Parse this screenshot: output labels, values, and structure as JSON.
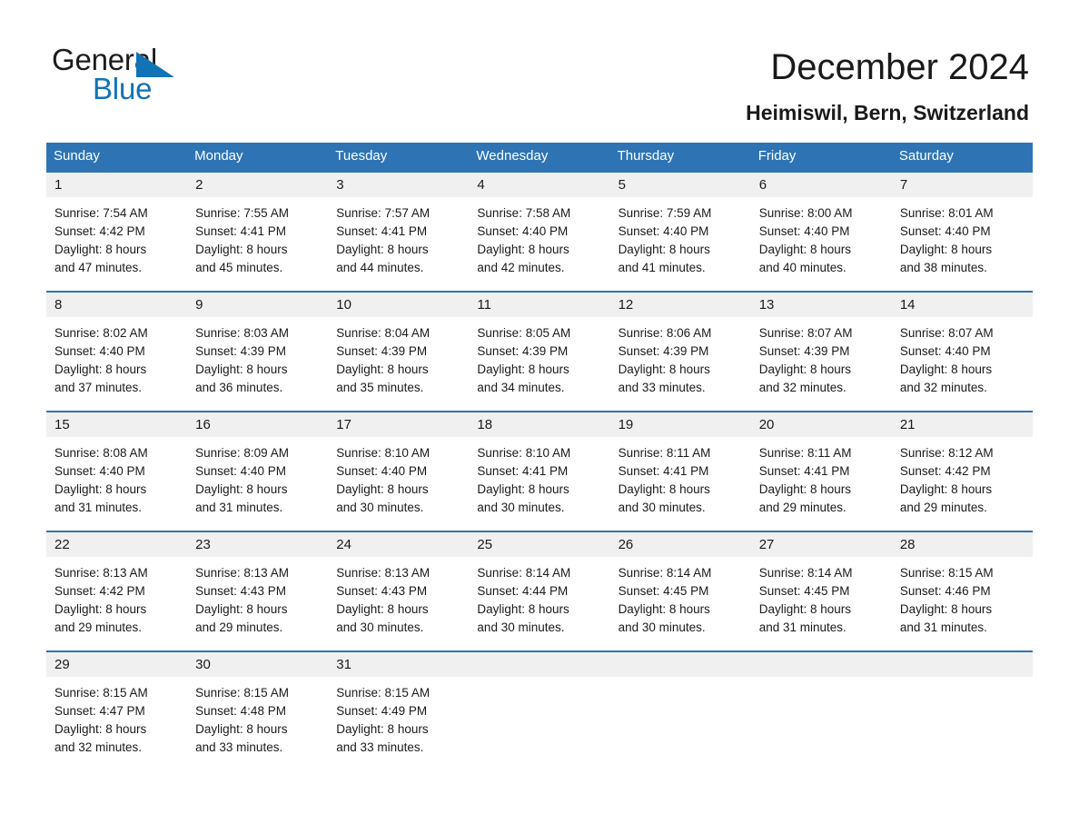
{
  "logo": {
    "word_black": "General",
    "word_blue": "Blue",
    "triangle_color": "#1272b6"
  },
  "header": {
    "title": "December 2024",
    "subtitle": "Heimiswil, Bern, Switzerland"
  },
  "colors": {
    "header_blue": "#2e74b5",
    "daynum_band": "#f0f0f0",
    "text": "#1a1a1a"
  },
  "weekday_headers": [
    "Sunday",
    "Monday",
    "Tuesday",
    "Wednesday",
    "Thursday",
    "Friday",
    "Saturday"
  ],
  "weeks": [
    [
      {
        "day": "1",
        "sunrise": "Sunrise: 7:54 AM",
        "sunset": "Sunset: 4:42 PM",
        "daylight_line1": "Daylight: 8 hours",
        "daylight_line2": "and 47 minutes."
      },
      {
        "day": "2",
        "sunrise": "Sunrise: 7:55 AM",
        "sunset": "Sunset: 4:41 PM",
        "daylight_line1": "Daylight: 8 hours",
        "daylight_line2": "and 45 minutes."
      },
      {
        "day": "3",
        "sunrise": "Sunrise: 7:57 AM",
        "sunset": "Sunset: 4:41 PM",
        "daylight_line1": "Daylight: 8 hours",
        "daylight_line2": "and 44 minutes."
      },
      {
        "day": "4",
        "sunrise": "Sunrise: 7:58 AM",
        "sunset": "Sunset: 4:40 PM",
        "daylight_line1": "Daylight: 8 hours",
        "daylight_line2": "and 42 minutes."
      },
      {
        "day": "5",
        "sunrise": "Sunrise: 7:59 AM",
        "sunset": "Sunset: 4:40 PM",
        "daylight_line1": "Daylight: 8 hours",
        "daylight_line2": "and 41 minutes."
      },
      {
        "day": "6",
        "sunrise": "Sunrise: 8:00 AM",
        "sunset": "Sunset: 4:40 PM",
        "daylight_line1": "Daylight: 8 hours",
        "daylight_line2": "and 40 minutes."
      },
      {
        "day": "7",
        "sunrise": "Sunrise: 8:01 AM",
        "sunset": "Sunset: 4:40 PM",
        "daylight_line1": "Daylight: 8 hours",
        "daylight_line2": "and 38 minutes."
      }
    ],
    [
      {
        "day": "8",
        "sunrise": "Sunrise: 8:02 AM",
        "sunset": "Sunset: 4:40 PM",
        "daylight_line1": "Daylight: 8 hours",
        "daylight_line2": "and 37 minutes."
      },
      {
        "day": "9",
        "sunrise": "Sunrise: 8:03 AM",
        "sunset": "Sunset: 4:39 PM",
        "daylight_line1": "Daylight: 8 hours",
        "daylight_line2": "and 36 minutes."
      },
      {
        "day": "10",
        "sunrise": "Sunrise: 8:04 AM",
        "sunset": "Sunset: 4:39 PM",
        "daylight_line1": "Daylight: 8 hours",
        "daylight_line2": "and 35 minutes."
      },
      {
        "day": "11",
        "sunrise": "Sunrise: 8:05 AM",
        "sunset": "Sunset: 4:39 PM",
        "daylight_line1": "Daylight: 8 hours",
        "daylight_line2": "and 34 minutes."
      },
      {
        "day": "12",
        "sunrise": "Sunrise: 8:06 AM",
        "sunset": "Sunset: 4:39 PM",
        "daylight_line1": "Daylight: 8 hours",
        "daylight_line2": "and 33 minutes."
      },
      {
        "day": "13",
        "sunrise": "Sunrise: 8:07 AM",
        "sunset": "Sunset: 4:39 PM",
        "daylight_line1": "Daylight: 8 hours",
        "daylight_line2": "and 32 minutes."
      },
      {
        "day": "14",
        "sunrise": "Sunrise: 8:07 AM",
        "sunset": "Sunset: 4:40 PM",
        "daylight_line1": "Daylight: 8 hours",
        "daylight_line2": "and 32 minutes."
      }
    ],
    [
      {
        "day": "15",
        "sunrise": "Sunrise: 8:08 AM",
        "sunset": "Sunset: 4:40 PM",
        "daylight_line1": "Daylight: 8 hours",
        "daylight_line2": "and 31 minutes."
      },
      {
        "day": "16",
        "sunrise": "Sunrise: 8:09 AM",
        "sunset": "Sunset: 4:40 PM",
        "daylight_line1": "Daylight: 8 hours",
        "daylight_line2": "and 31 minutes."
      },
      {
        "day": "17",
        "sunrise": "Sunrise: 8:10 AM",
        "sunset": "Sunset: 4:40 PM",
        "daylight_line1": "Daylight: 8 hours",
        "daylight_line2": "and 30 minutes."
      },
      {
        "day": "18",
        "sunrise": "Sunrise: 8:10 AM",
        "sunset": "Sunset: 4:41 PM",
        "daylight_line1": "Daylight: 8 hours",
        "daylight_line2": "and 30 minutes."
      },
      {
        "day": "19",
        "sunrise": "Sunrise: 8:11 AM",
        "sunset": "Sunset: 4:41 PM",
        "daylight_line1": "Daylight: 8 hours",
        "daylight_line2": "and 30 minutes."
      },
      {
        "day": "20",
        "sunrise": "Sunrise: 8:11 AM",
        "sunset": "Sunset: 4:41 PM",
        "daylight_line1": "Daylight: 8 hours",
        "daylight_line2": "and 29 minutes."
      },
      {
        "day": "21",
        "sunrise": "Sunrise: 8:12 AM",
        "sunset": "Sunset: 4:42 PM",
        "daylight_line1": "Daylight: 8 hours",
        "daylight_line2": "and 29 minutes."
      }
    ],
    [
      {
        "day": "22",
        "sunrise": "Sunrise: 8:13 AM",
        "sunset": "Sunset: 4:42 PM",
        "daylight_line1": "Daylight: 8 hours",
        "daylight_line2": "and 29 minutes."
      },
      {
        "day": "23",
        "sunrise": "Sunrise: 8:13 AM",
        "sunset": "Sunset: 4:43 PM",
        "daylight_line1": "Daylight: 8 hours",
        "daylight_line2": "and 29 minutes."
      },
      {
        "day": "24",
        "sunrise": "Sunrise: 8:13 AM",
        "sunset": "Sunset: 4:43 PM",
        "daylight_line1": "Daylight: 8 hours",
        "daylight_line2": "and 30 minutes."
      },
      {
        "day": "25",
        "sunrise": "Sunrise: 8:14 AM",
        "sunset": "Sunset: 4:44 PM",
        "daylight_line1": "Daylight: 8 hours",
        "daylight_line2": "and 30 minutes."
      },
      {
        "day": "26",
        "sunrise": "Sunrise: 8:14 AM",
        "sunset": "Sunset: 4:45 PM",
        "daylight_line1": "Daylight: 8 hours",
        "daylight_line2": "and 30 minutes."
      },
      {
        "day": "27",
        "sunrise": "Sunrise: 8:14 AM",
        "sunset": "Sunset: 4:45 PM",
        "daylight_line1": "Daylight: 8 hours",
        "daylight_line2": "and 31 minutes."
      },
      {
        "day": "28",
        "sunrise": "Sunrise: 8:15 AM",
        "sunset": "Sunset: 4:46 PM",
        "daylight_line1": "Daylight: 8 hours",
        "daylight_line2": "and 31 minutes."
      }
    ],
    [
      {
        "day": "29",
        "sunrise": "Sunrise: 8:15 AM",
        "sunset": "Sunset: 4:47 PM",
        "daylight_line1": "Daylight: 8 hours",
        "daylight_line2": "and 32 minutes."
      },
      {
        "day": "30",
        "sunrise": "Sunrise: 8:15 AM",
        "sunset": "Sunset: 4:48 PM",
        "daylight_line1": "Daylight: 8 hours",
        "daylight_line2": "and 33 minutes."
      },
      {
        "day": "31",
        "sunrise": "Sunrise: 8:15 AM",
        "sunset": "Sunset: 4:49 PM",
        "daylight_line1": "Daylight: 8 hours",
        "daylight_line2": "and 33 minutes."
      },
      {
        "day": "",
        "sunrise": "",
        "sunset": "",
        "daylight_line1": "",
        "daylight_line2": ""
      },
      {
        "day": "",
        "sunrise": "",
        "sunset": "",
        "daylight_line1": "",
        "daylight_line2": ""
      },
      {
        "day": "",
        "sunrise": "",
        "sunset": "",
        "daylight_line1": "",
        "daylight_line2": ""
      },
      {
        "day": "",
        "sunrise": "",
        "sunset": "",
        "daylight_line1": "",
        "daylight_line2": ""
      }
    ]
  ]
}
